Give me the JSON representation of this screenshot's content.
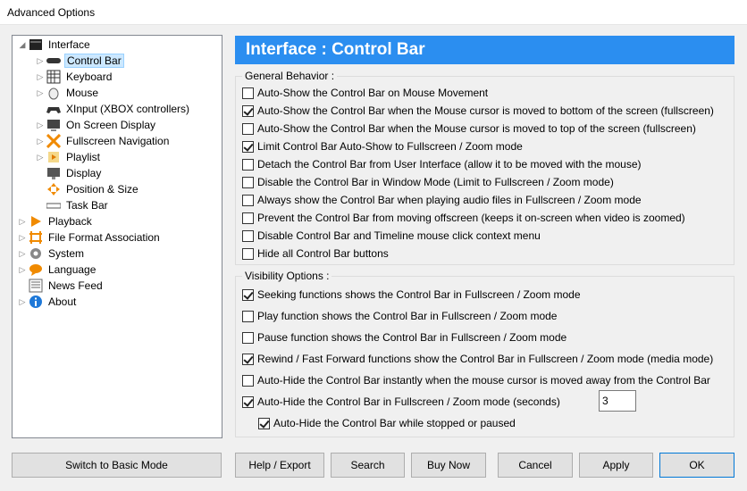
{
  "window": {
    "title": "Advanced Options"
  },
  "tree": {
    "items": [
      {
        "label": "Interface",
        "icon": "interface-icon"
      },
      {
        "label": "Control Bar",
        "icon": "control-bar-icon"
      },
      {
        "label": "Keyboard",
        "icon": "keyboard-icon"
      },
      {
        "label": "Mouse",
        "icon": "mouse-icon"
      },
      {
        "label": "XInput (XBOX controllers)",
        "icon": "gamepad-icon"
      },
      {
        "label": "On Screen Display",
        "icon": "osd-icon"
      },
      {
        "label": "Fullscreen Navigation",
        "icon": "fullscreen-icon"
      },
      {
        "label": "Playlist",
        "icon": "playlist-icon"
      },
      {
        "label": "Display",
        "icon": "display-icon"
      },
      {
        "label": "Position & Size",
        "icon": "position-icon"
      },
      {
        "label": "Task Bar",
        "icon": "taskbar-icon"
      },
      {
        "label": "Playback",
        "icon": "playback-icon"
      },
      {
        "label": "File Format Association",
        "icon": "file-format-icon"
      },
      {
        "label": "System",
        "icon": "gear-icon"
      },
      {
        "label": "Language",
        "icon": "language-icon"
      },
      {
        "label": "News Feed",
        "icon": "news-icon"
      },
      {
        "label": "About",
        "icon": "info-icon"
      }
    ]
  },
  "header": {
    "title": "Interface : Control Bar"
  },
  "general": {
    "title": "General Behavior :",
    "options": [
      {
        "label": "Auto-Show the Control Bar on Mouse Movement",
        "checked": false
      },
      {
        "label": "Auto-Show the Control Bar when the Mouse cursor is moved to bottom of the screen (fullscreen)",
        "checked": true
      },
      {
        "label": "Auto-Show the Control Bar when the Mouse cursor is moved to top of the screen (fullscreen)",
        "checked": false
      },
      {
        "label": "Limit Control Bar Auto-Show to Fullscreen / Zoom mode",
        "checked": true
      },
      {
        "label": "Detach the Control Bar from User Interface (allow it to be moved with the mouse)",
        "checked": false
      },
      {
        "label": "Disable the Control Bar in Window Mode (Limit to Fullscreen / Zoom mode)",
        "checked": false
      },
      {
        "label": "Always show the Control Bar when playing audio files in Fullscreen / Zoom mode",
        "checked": false
      },
      {
        "label": "Prevent the Control Bar from moving offscreen (keeps it on-screen when video is zoomed)",
        "checked": false
      },
      {
        "label": "Disable Control Bar and Timeline mouse click context menu",
        "checked": false
      },
      {
        "label": "Hide all Control Bar buttons",
        "checked": false
      }
    ]
  },
  "visibility": {
    "title": "Visibility Options :",
    "options": [
      {
        "label": "Seeking functions shows the Control Bar in Fullscreen / Zoom mode",
        "checked": true
      },
      {
        "label": "Play function shows the Control Bar in Fullscreen / Zoom mode",
        "checked": false
      },
      {
        "label": "Pause function shows the Control Bar in Fullscreen / Zoom mode",
        "checked": false
      },
      {
        "label": "Rewind / Fast Forward functions show the Control Bar in Fullscreen / Zoom mode (media mode)",
        "checked": true
      },
      {
        "label": "Auto-Hide the Control Bar instantly when the mouse cursor is moved away from the Control Bar",
        "checked": false
      },
      {
        "label": "Auto-Hide the Control Bar in Fullscreen / Zoom mode (seconds)",
        "checked": true
      },
      {
        "label": "Auto-Hide the Control Bar while stopped or paused",
        "checked": true
      }
    ],
    "seconds_value": "3"
  },
  "buttons": {
    "basic_mode": "Switch to Basic Mode",
    "help_export": "Help / Export",
    "search": "Search",
    "buy_now": "Buy Now",
    "cancel": "Cancel",
    "apply": "Apply",
    "ok": "OK"
  },
  "colors": {
    "header_bg": "#2b8ef0",
    "selection_bg": "#cce8ff"
  }
}
